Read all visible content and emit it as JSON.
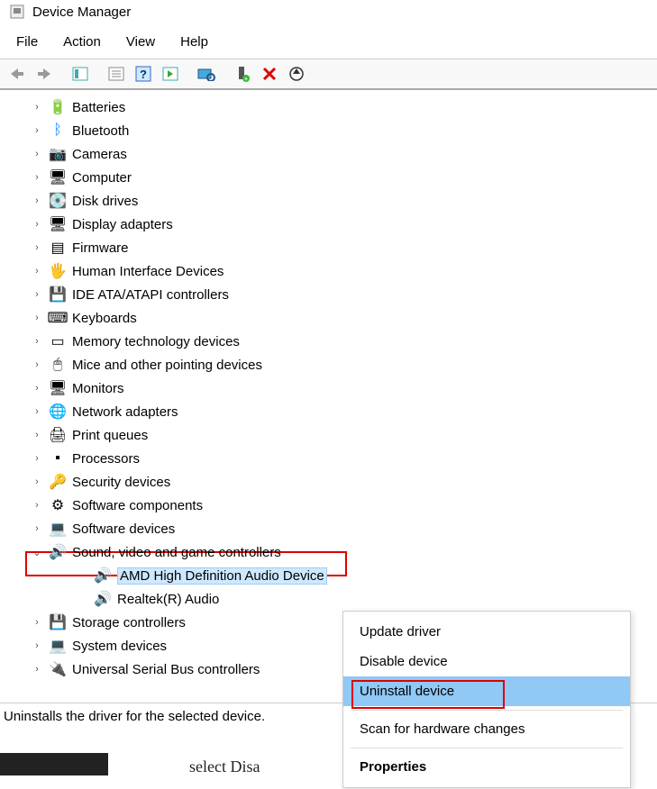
{
  "window": {
    "title": "Device Manager"
  },
  "menu": {
    "file": "File",
    "action": "Action",
    "view": "View",
    "help": "Help"
  },
  "toolbar_icons": {
    "back": "⬅",
    "forward": "➡",
    "props": "📋",
    "list": "📄",
    "help": "?",
    "proplist": "📑",
    "scan": "🔍",
    "add": "➕",
    "delete": "✖",
    "update": "⟳"
  },
  "tree": [
    {
      "label": "Batteries",
      "icon": "🔋",
      "expanded": false
    },
    {
      "label": "Bluetooth",
      "icon": "ᛒ",
      "iconColor": "#0a84ff",
      "expanded": false
    },
    {
      "label": "Cameras",
      "icon": "📷",
      "expanded": false
    },
    {
      "label": "Computer",
      "icon": "🖥",
      "expanded": false
    },
    {
      "label": "Disk drives",
      "icon": "💽",
      "expanded": false
    },
    {
      "label": "Display adapters",
      "icon": "🖥",
      "expanded": false
    },
    {
      "label": "Firmware",
      "icon": "▤",
      "expanded": false
    },
    {
      "label": "Human Interface Devices",
      "icon": "🖐",
      "expanded": false
    },
    {
      "label": "IDE ATA/ATAPI controllers",
      "icon": "💾",
      "expanded": false
    },
    {
      "label": "Keyboards",
      "icon": "⌨",
      "expanded": false
    },
    {
      "label": "Memory technology devices",
      "icon": "▭",
      "expanded": false
    },
    {
      "label": "Mice and other pointing devices",
      "icon": "🖱",
      "expanded": false
    },
    {
      "label": "Monitors",
      "icon": "🖥",
      "expanded": false
    },
    {
      "label": "Network adapters",
      "icon": "🌐",
      "expanded": false
    },
    {
      "label": "Print queues",
      "icon": "🖨",
      "expanded": false
    },
    {
      "label": "Processors",
      "icon": "▪",
      "expanded": false
    },
    {
      "label": "Security devices",
      "icon": "🔑",
      "expanded": false
    },
    {
      "label": "Software components",
      "icon": "⚙",
      "expanded": false
    },
    {
      "label": "Software devices",
      "icon": "💻",
      "expanded": false
    },
    {
      "label": "Sound, video and game controllers",
      "icon": "🔊",
      "expanded": true,
      "children": [
        {
          "label": "AMD High Definition Audio Device",
          "icon": "🔊",
          "selected": true
        },
        {
          "label": "Realtek(R) Audio",
          "icon": "🔊"
        }
      ]
    },
    {
      "label": "Storage controllers",
      "icon": "💾",
      "expanded": false
    },
    {
      "label": "System devices",
      "icon": "💻",
      "expanded": false
    },
    {
      "label": "Universal Serial Bus controllers",
      "icon": "🔌",
      "expanded": false
    }
  ],
  "context_menu": {
    "update": "Update driver",
    "disable": "Disable device",
    "uninstall": "Uninstall device",
    "scan": "Scan for hardware changes",
    "properties": "Properties"
  },
  "status": "Uninstalls the driver for the selected device.",
  "bottom_fragment": "select Disa"
}
